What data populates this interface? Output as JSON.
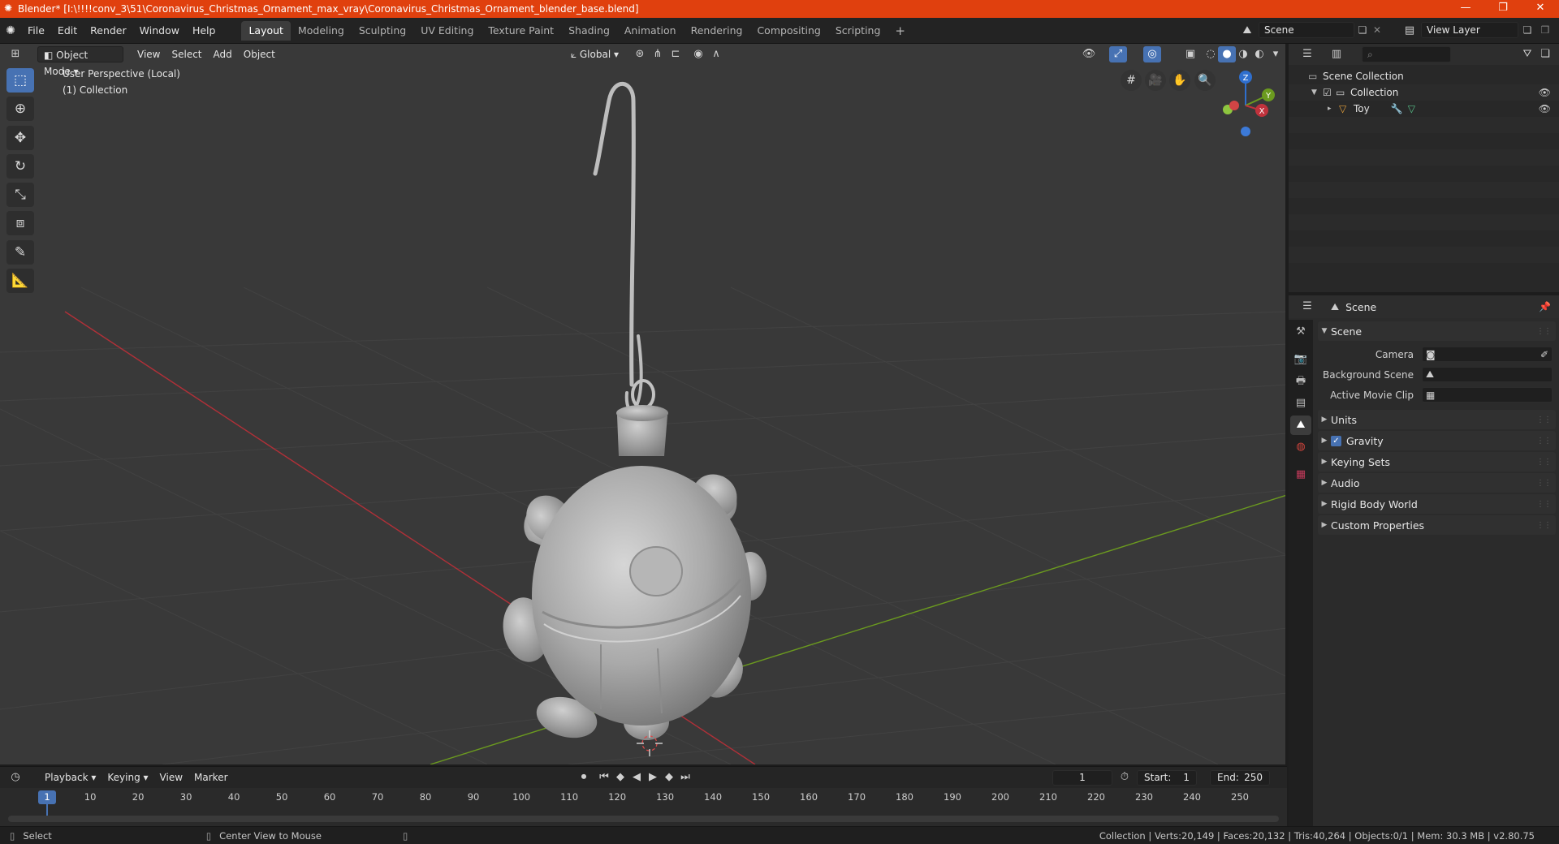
{
  "app": {
    "window_title": "Blender* [I:\\!!!!conv_3\\51\\Coronavirus_Christmas_Ornament_max_vray\\Coronavirus_Christmas_Ornament_blender_base.blend]",
    "minimize": "—",
    "maximize": "❐",
    "close": "✕"
  },
  "menubar": {
    "menus": [
      "File",
      "Edit",
      "Render",
      "Window",
      "Help"
    ],
    "workspaces": [
      "Layout",
      "Modeling",
      "Sculpting",
      "UV Editing",
      "Texture Paint",
      "Shading",
      "Animation",
      "Rendering",
      "Compositing",
      "Scripting"
    ],
    "add_workspace": "+",
    "scene_name": "Scene",
    "view_layer": "View Layer"
  },
  "viewport": {
    "mode": "Object Mode",
    "menus": [
      "View",
      "Select",
      "Add",
      "Object"
    ],
    "transform_orientation": "Global",
    "overlay_line1": "User Perspective (Local)",
    "overlay_line2": "(1) Collection",
    "gizmo_axes": {
      "z": "Z",
      "y": "Y",
      "x": "X"
    },
    "colors": {
      "x_axis": "#c0323c",
      "y_axis": "#6b9a1f",
      "z_axis": "#2f6fce",
      "accent": "#4772b3",
      "title_bar": "#e0400e"
    }
  },
  "timeline": {
    "menus": [
      "Playback",
      "Keying",
      "View",
      "Marker"
    ],
    "current_frame": "1",
    "start_label": "Start:",
    "start_value": "1",
    "end_label": "End:",
    "end_value": "250",
    "ruler_ticks": [
      "10",
      "20",
      "30",
      "40",
      "50",
      "60",
      "70",
      "80",
      "90",
      "100",
      "110",
      "120",
      "130",
      "140",
      "150",
      "160",
      "170",
      "180",
      "190",
      "200",
      "210",
      "220",
      "230",
      "240",
      "250"
    ],
    "frame_marker": "1"
  },
  "outliner": {
    "root": "Scene Collection",
    "collection": "Collection",
    "object": "Toy"
  },
  "properties": {
    "context_name": "Scene",
    "panel_scene": "Scene",
    "fields": [
      {
        "label": "Camera"
      },
      {
        "label": "Background Scene"
      },
      {
        "label": "Active Movie Clip"
      }
    ],
    "subpanels": [
      "Units",
      "Gravity",
      "Keying Sets",
      "Audio",
      "Rigid Body World",
      "Custom Properties"
    ],
    "gravity_checked": true
  },
  "statusbar": {
    "left_action": "Select",
    "mid_action": "Center View to Mouse",
    "stats": "Collection | Verts:20,149 | Faces:20,132 | Tris:40,264 | Objects:0/1 | Mem: 30.3 MB | v2.80.75"
  }
}
